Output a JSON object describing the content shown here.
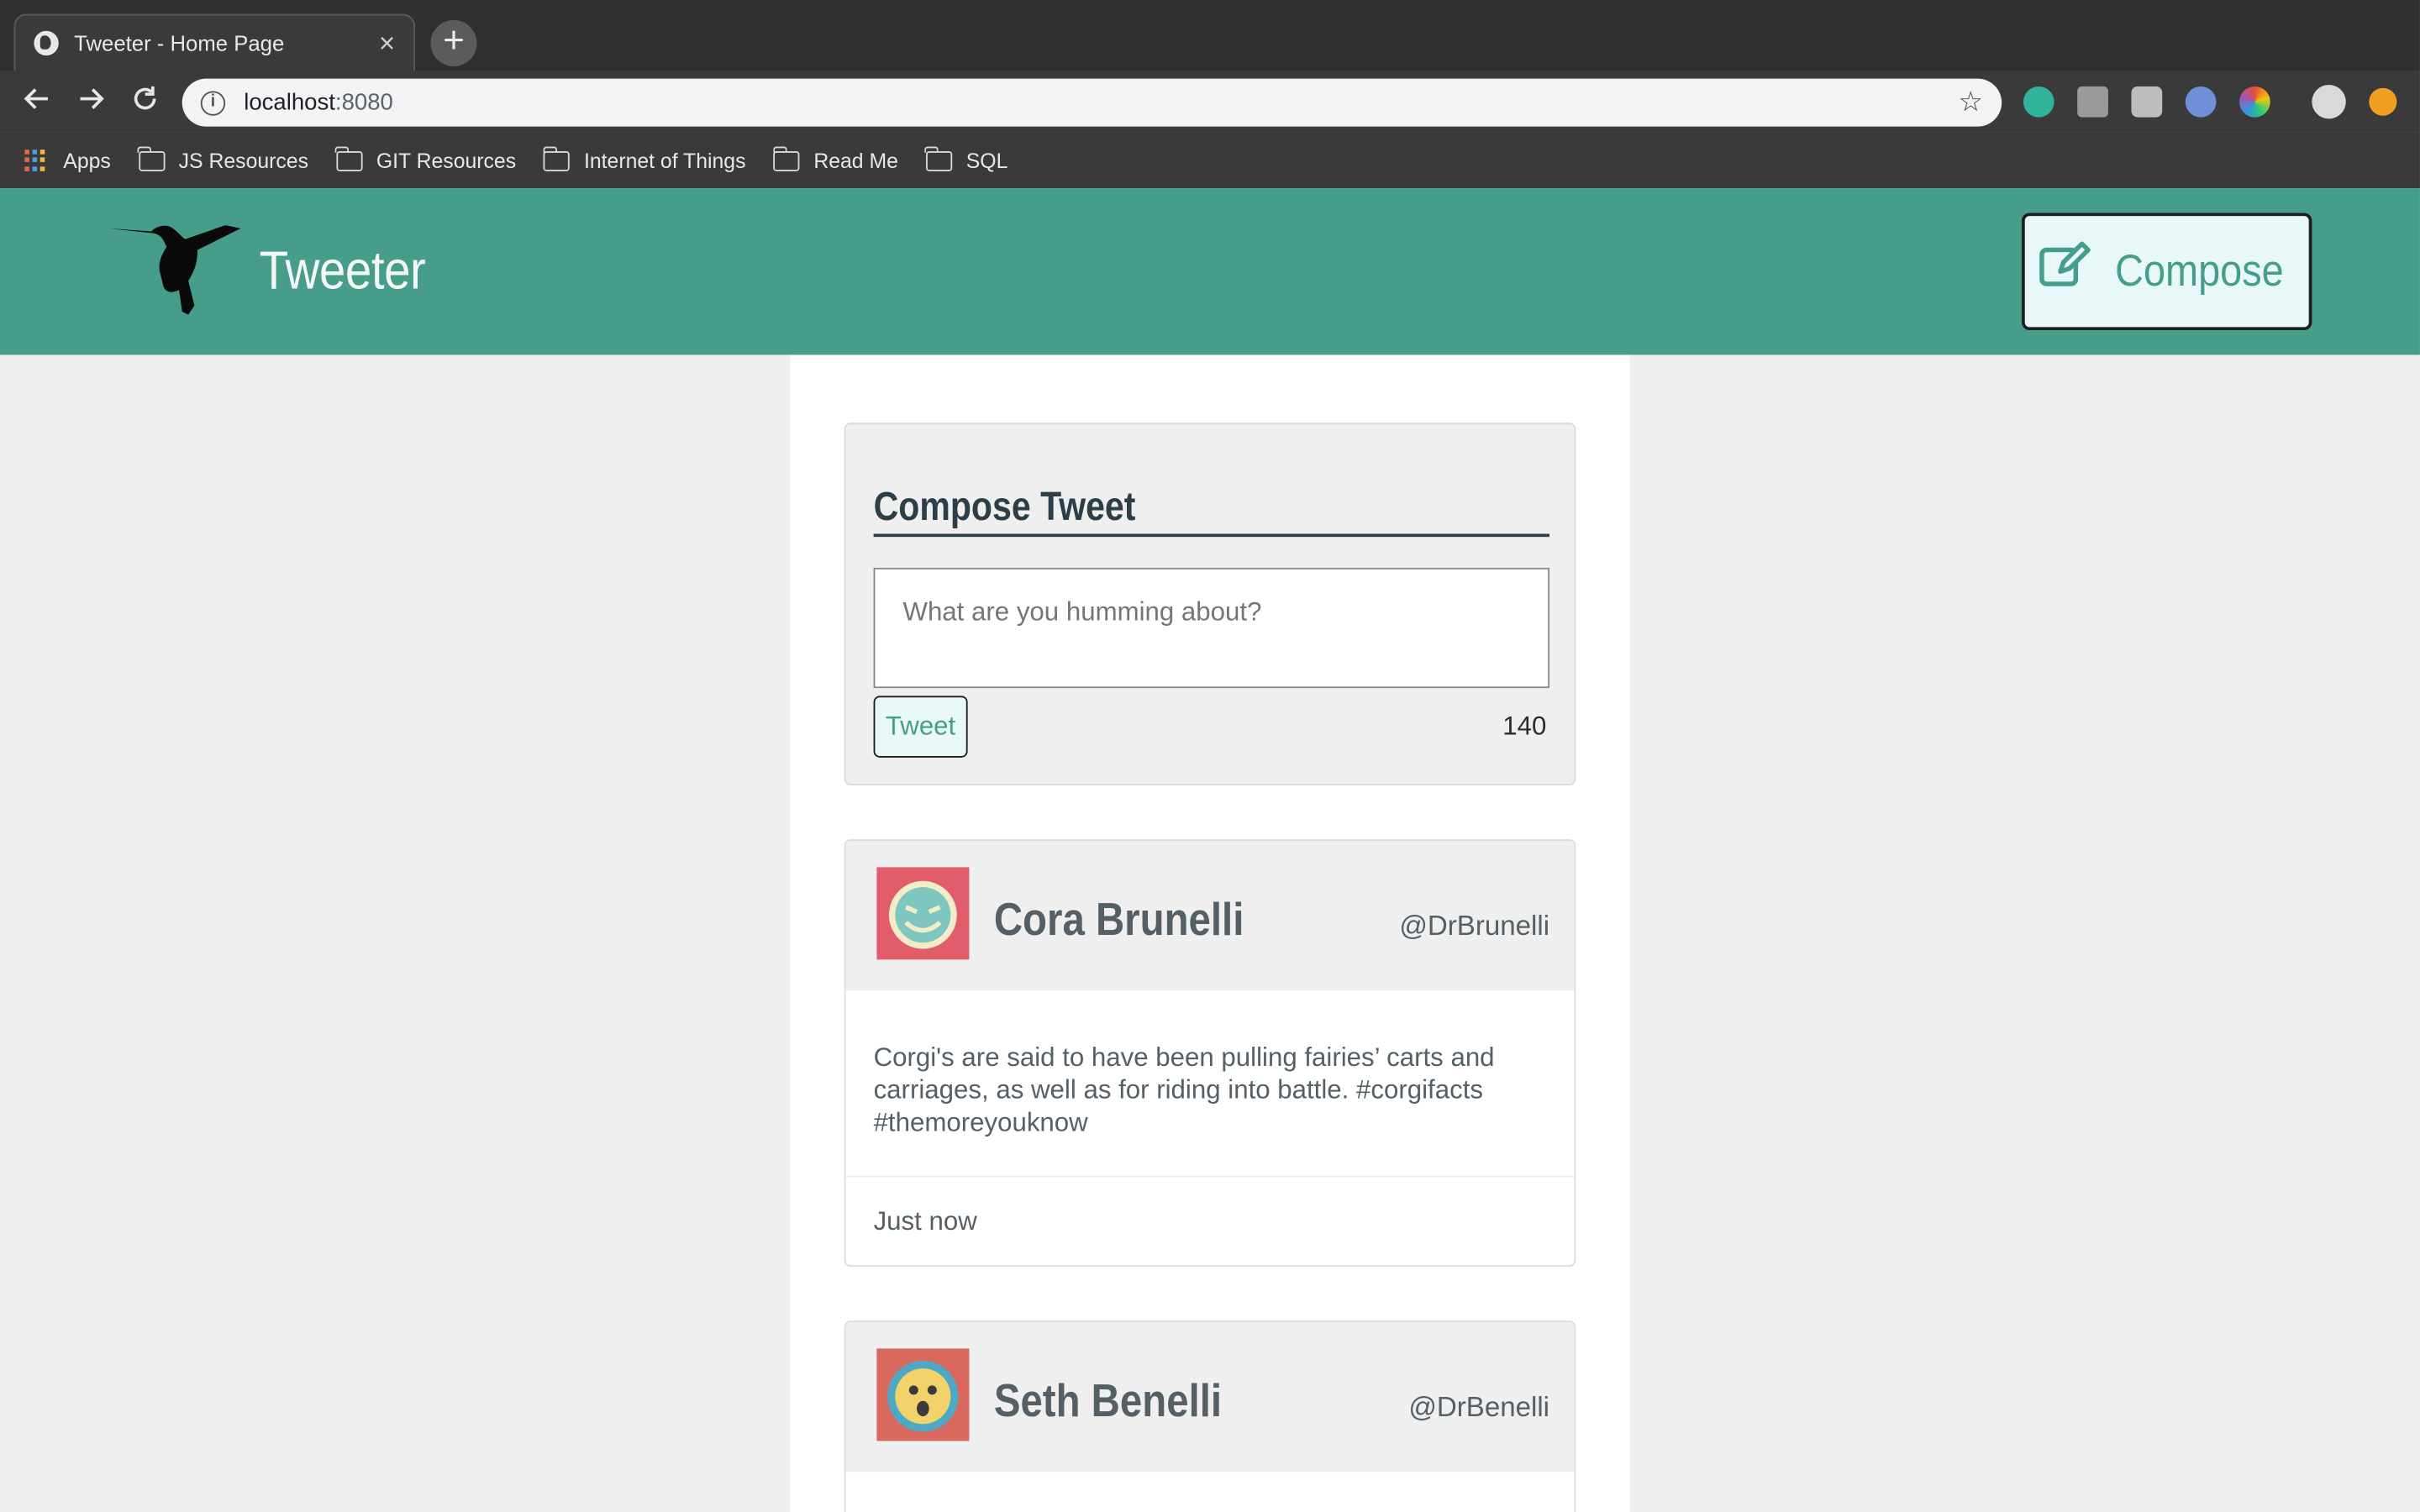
{
  "browser": {
    "tab_title": "Tweeter - Home Page",
    "tab_close": "×",
    "new_tab": "+",
    "url_host": "localhost",
    "url_port": ":8080",
    "bookmarks": [
      {
        "label": "Apps"
      },
      {
        "label": "JS Resources"
      },
      {
        "label": "GIT Resources"
      },
      {
        "label": "Internet of Things"
      },
      {
        "label": "Read Me"
      },
      {
        "label": "SQL"
      }
    ]
  },
  "nav": {
    "brand": "Tweeter",
    "compose_label": "Compose"
  },
  "compose": {
    "title": "Compose Tweet",
    "placeholder": "What are you humming about?",
    "submit_label": "Tweet",
    "counter": "140"
  },
  "tweets": [
    {
      "name": "Cora Brunelli",
      "handle": "@DrBrunelli",
      "body": "Corgi's are said to have been pulling fairies’ carts and carriages, as well as for riding into battle. #corgifacts #themoreyouknow",
      "time": "Just now"
    },
    {
      "name": "Seth Benelli",
      "handle": "@DrBenelli"
    }
  ],
  "colors": {
    "brand_green": "#469e8a",
    "button_bg": "#e8f8f8",
    "text_dark": "#2c3f49",
    "text_muted": "#545f66"
  }
}
